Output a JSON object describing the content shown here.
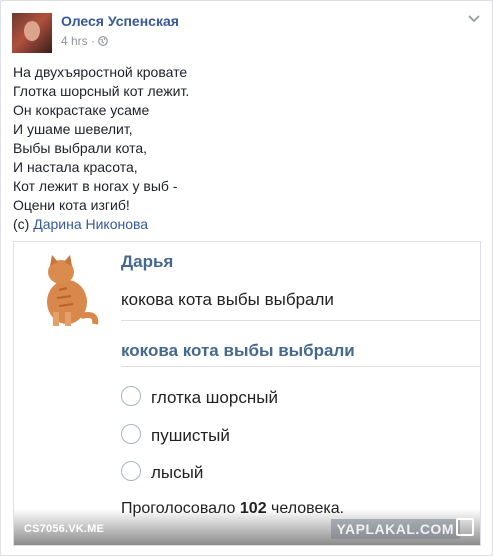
{
  "post": {
    "author": "Олеся Успенская",
    "time": "4 hrs",
    "separator": "·",
    "privacy_icon": "globe-icon",
    "menu_icon": "chevron-down-icon",
    "poem_lines": [
      "На двухъяростной кровате",
      "Глотка шорсный кот лежит.",
      "Он кокрастаке усаме",
      "И ушаме шевелит,",
      "Выбы выбрали кота,",
      "И настала красота,",
      "Кот лежит в ногах у выб -",
      "Оцени кота изгиб!"
    ],
    "credit_prefix": "(c) ",
    "credit_name": "Дарина Никонова"
  },
  "shared": {
    "vk_author": "Дарья",
    "question": "кокова кота выбы выбрали",
    "poll_title": "кокова кота выбы выбрали",
    "options": [
      "глотка шорсный",
      "пушистый",
      "лысый"
    ],
    "voted_prefix": "Проголосовало ",
    "voted_count": "102",
    "voted_suffix": " человека.",
    "domain": "CS7056.VK.ME",
    "watermark": "YAPLAKAL.COM"
  }
}
